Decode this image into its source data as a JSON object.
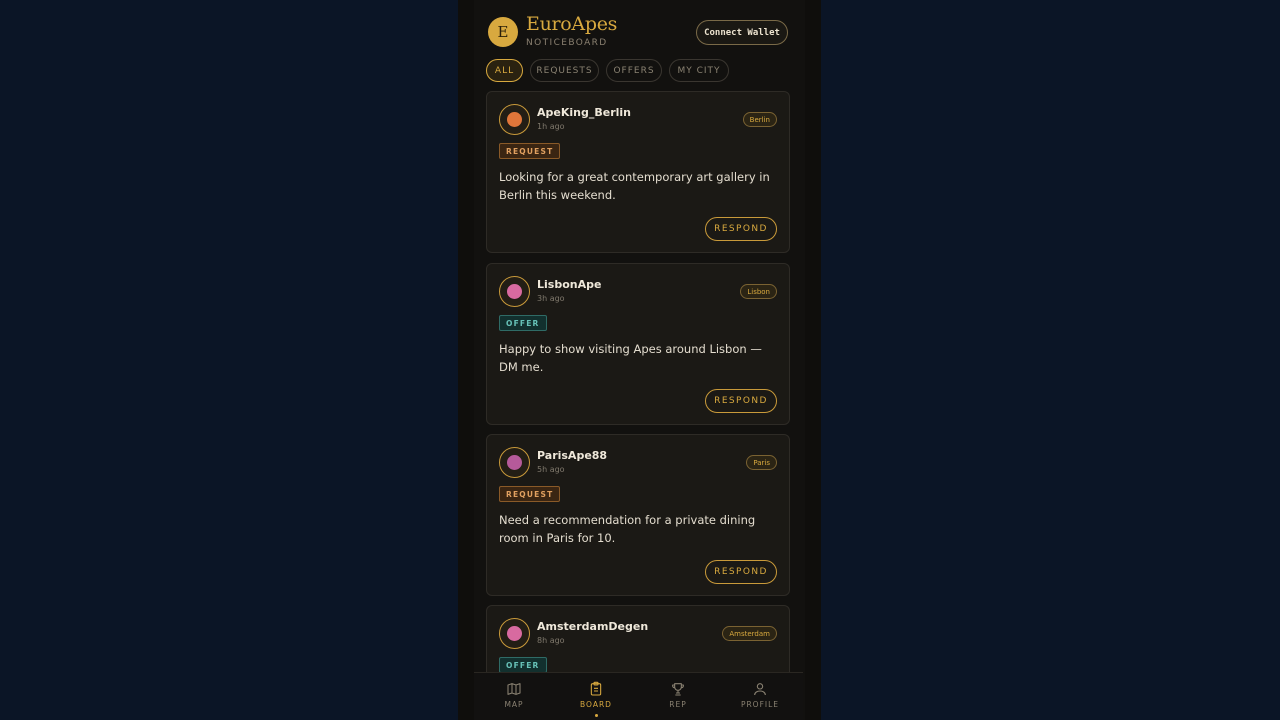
{
  "header": {
    "logo_letter": "E",
    "title": "EuroApes",
    "subtitle": "NOTICEBOARD",
    "wallet_button": "Connect Wallet"
  },
  "filters": [
    {
      "label": "ALL",
      "active": true
    },
    {
      "label": "REQUESTS",
      "active": false
    },
    {
      "label": "OFFERS",
      "active": false
    },
    {
      "label": "MY CITY",
      "active": false
    }
  ],
  "posts": [
    {
      "user": "ApeKing_Berlin",
      "time": "1h ago",
      "city": "Berlin",
      "type": "REQUEST",
      "text": "Looking for a great contemporary art gallery in Berlin this weekend.",
      "respond": "RESPOND",
      "avatar_color": "#e0763a"
    },
    {
      "user": "LisbonApe",
      "time": "3h ago",
      "city": "Lisbon",
      "type": "OFFER",
      "text": "Happy to show visiting Apes around Lisbon — DM me.",
      "respond": "RESPOND",
      "avatar_color": "#d86aa0"
    },
    {
      "user": "ParisApe88",
      "time": "5h ago",
      "city": "Paris",
      "type": "REQUEST",
      "text": "Need a recommendation for a private dining room in Paris for 10.",
      "respond": "RESPOND",
      "avatar_color": "#b55a9a"
    },
    {
      "user": "AmsterdamDegen",
      "time": "8h ago",
      "city": "Amsterdam",
      "type": "OFFER",
      "text": "",
      "respond": "",
      "avatar_color": "#d86aa0"
    }
  ],
  "nav": [
    {
      "label": "MAP",
      "icon": "map-icon",
      "active": false
    },
    {
      "label": "BOARD",
      "icon": "clipboard-icon",
      "active": true
    },
    {
      "label": "REP",
      "icon": "trophy-icon",
      "active": false
    },
    {
      "label": "PROFILE",
      "icon": "user-icon",
      "active": false
    }
  ],
  "colors": {
    "accent": "#d8a93f",
    "background": "#0b1526",
    "request": "#e0a060",
    "offer": "#67c2b8"
  }
}
